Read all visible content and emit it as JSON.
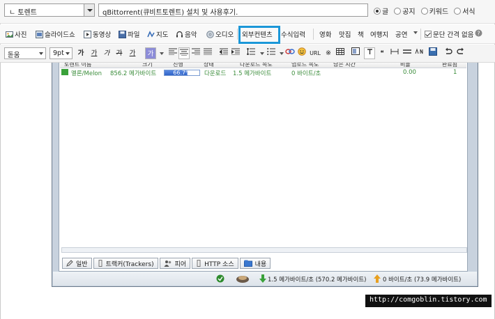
{
  "header": {
    "category_value": "ㄴ 토렌트",
    "title_value": "qBittorrent(큐비트토렌트) 설치 및 사용후기.",
    "visibility": [
      {
        "label": "글",
        "selected": true
      },
      {
        "label": "공지",
        "selected": false
      },
      {
        "label": "키워드",
        "selected": false
      },
      {
        "label": "서식",
        "selected": false
      }
    ]
  },
  "insert_toolbar": {
    "items": [
      "사진",
      "슬라이드쇼",
      "동영상",
      "파일",
      "지도",
      "음악",
      "오디오"
    ],
    "external_content": "외부컨텐츠",
    "formula": "수식입력",
    "categories": [
      "영화",
      "맛집",
      "책",
      "여행지",
      "공연"
    ],
    "paragraph_gap_label": "문단 간격 없음",
    "paragraph_gap_checked": true
  },
  "format_toolbar": {
    "font": "돋움",
    "size": "9pt",
    "style_buttons": [
      "가",
      "가",
      "가",
      "가",
      "가",
      "가"
    ],
    "url_label": "URL"
  },
  "torrent_window": {
    "columns": [
      "토렌트 이름",
      "크기",
      "진행",
      "상태",
      "다운로드 속도",
      "업로드 속도",
      "남은 시간",
      "비율",
      "완료됨"
    ],
    "rows": [
      {
        "name": "멜론/Melon",
        "size": "856.2 메가바이트",
        "progress_label": "66.7%",
        "progress": 0.667,
        "status": "다운로드",
        "down_speed": "1.5 메가바이트",
        "up_speed": "0 바이트/초",
        "ratio": "0.00",
        "done": "1"
      }
    ],
    "tabs": [
      "일반",
      "트랙커(Trackers)",
      "피어",
      "HTTP 소스",
      "내용"
    ],
    "status_down": "1.5 메가바이트/초 (570.2 메가바이트)",
    "status_up": "0 바이트/초 (73.9 메가바이트)"
  },
  "watermark": "http://comgoblin.tistory.com",
  "colors": {
    "highlight": "#1b97d8",
    "progress": "#2f63c8",
    "row_text": "#3a8c3a"
  }
}
